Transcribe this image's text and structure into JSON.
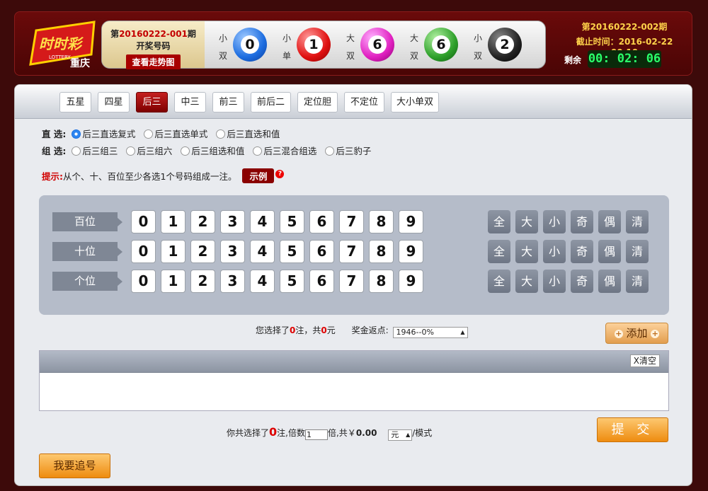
{
  "header": {
    "logo_text": "时时彩",
    "logo_sub": "LOTTERY",
    "city": "重庆",
    "draw": {
      "prefix": "第",
      "issue": "20160222-001",
      "suffix": "期",
      "title": "开奖号码",
      "trend_button": "查看走势图"
    },
    "balls": [
      {
        "tag1": "小",
        "tag2": "双",
        "number": "0",
        "color": "blue"
      },
      {
        "tag1": "小",
        "tag2": "单",
        "number": "1",
        "color": "red"
      },
      {
        "tag1": "大",
        "tag2": "双",
        "number": "6",
        "color": "pink"
      },
      {
        "tag1": "大",
        "tag2": "双",
        "number": "6",
        "color": "green"
      },
      {
        "tag1": "小",
        "tag2": "双",
        "number": "2",
        "color": "black"
      }
    ],
    "next": {
      "issue_line": "第20160222-002期",
      "deadline_line": "截止时间：2016-02-22 00:10",
      "remaining_label": "剩余",
      "countdown": "00: 02: 06"
    }
  },
  "tabs": [
    {
      "label": "五星",
      "active": false
    },
    {
      "label": "四星",
      "active": false
    },
    {
      "label": "后三",
      "active": true
    },
    {
      "label": "中三",
      "active": false
    },
    {
      "label": "前三",
      "active": false
    },
    {
      "label": "前后二",
      "active": false
    },
    {
      "label": "定位胆",
      "active": false
    },
    {
      "label": "不定位",
      "active": false
    },
    {
      "label": "大小单双",
      "active": false
    }
  ],
  "options": {
    "direct_label": "直 选:",
    "direct": [
      "后三直选复式",
      "后三直选单式",
      "后三直选和值"
    ],
    "direct_selected": 0,
    "group_label": "组 选:",
    "group": [
      "后三组三",
      "后三组六",
      "后三组选和值",
      "后三混合组选",
      "后三豹子"
    ]
  },
  "hint": {
    "key": "提示:",
    "text": "从个、十、百位至少各选1个号码组成一注。",
    "example_button": "示例",
    "help_icon": "?"
  },
  "picker": {
    "rows": [
      "百位",
      "十位",
      "个位"
    ],
    "digits": [
      "0",
      "1",
      "2",
      "3",
      "4",
      "5",
      "6",
      "7",
      "8",
      "9"
    ],
    "quick": [
      "全",
      "大",
      "小",
      "奇",
      "偶",
      "清"
    ]
  },
  "summary": {
    "text1": "您选择了",
    "count": "0",
    "text2": "注，共",
    "amount": "0",
    "text3": "元",
    "rebate_label": "奖金返点:",
    "rebate_value": "1946--0%"
  },
  "add_button": "添加",
  "list": {
    "clear_button": "X清空"
  },
  "bottom": {
    "text1": "你共选择了",
    "count": "0",
    "text2": "注,倍数",
    "multiplier": "1",
    "text3": "倍,共￥",
    "total": "0.00",
    "unit": "元",
    "mode_label": "/模式"
  },
  "submit_button": "提 交",
  "chase_button": "我要追号"
}
